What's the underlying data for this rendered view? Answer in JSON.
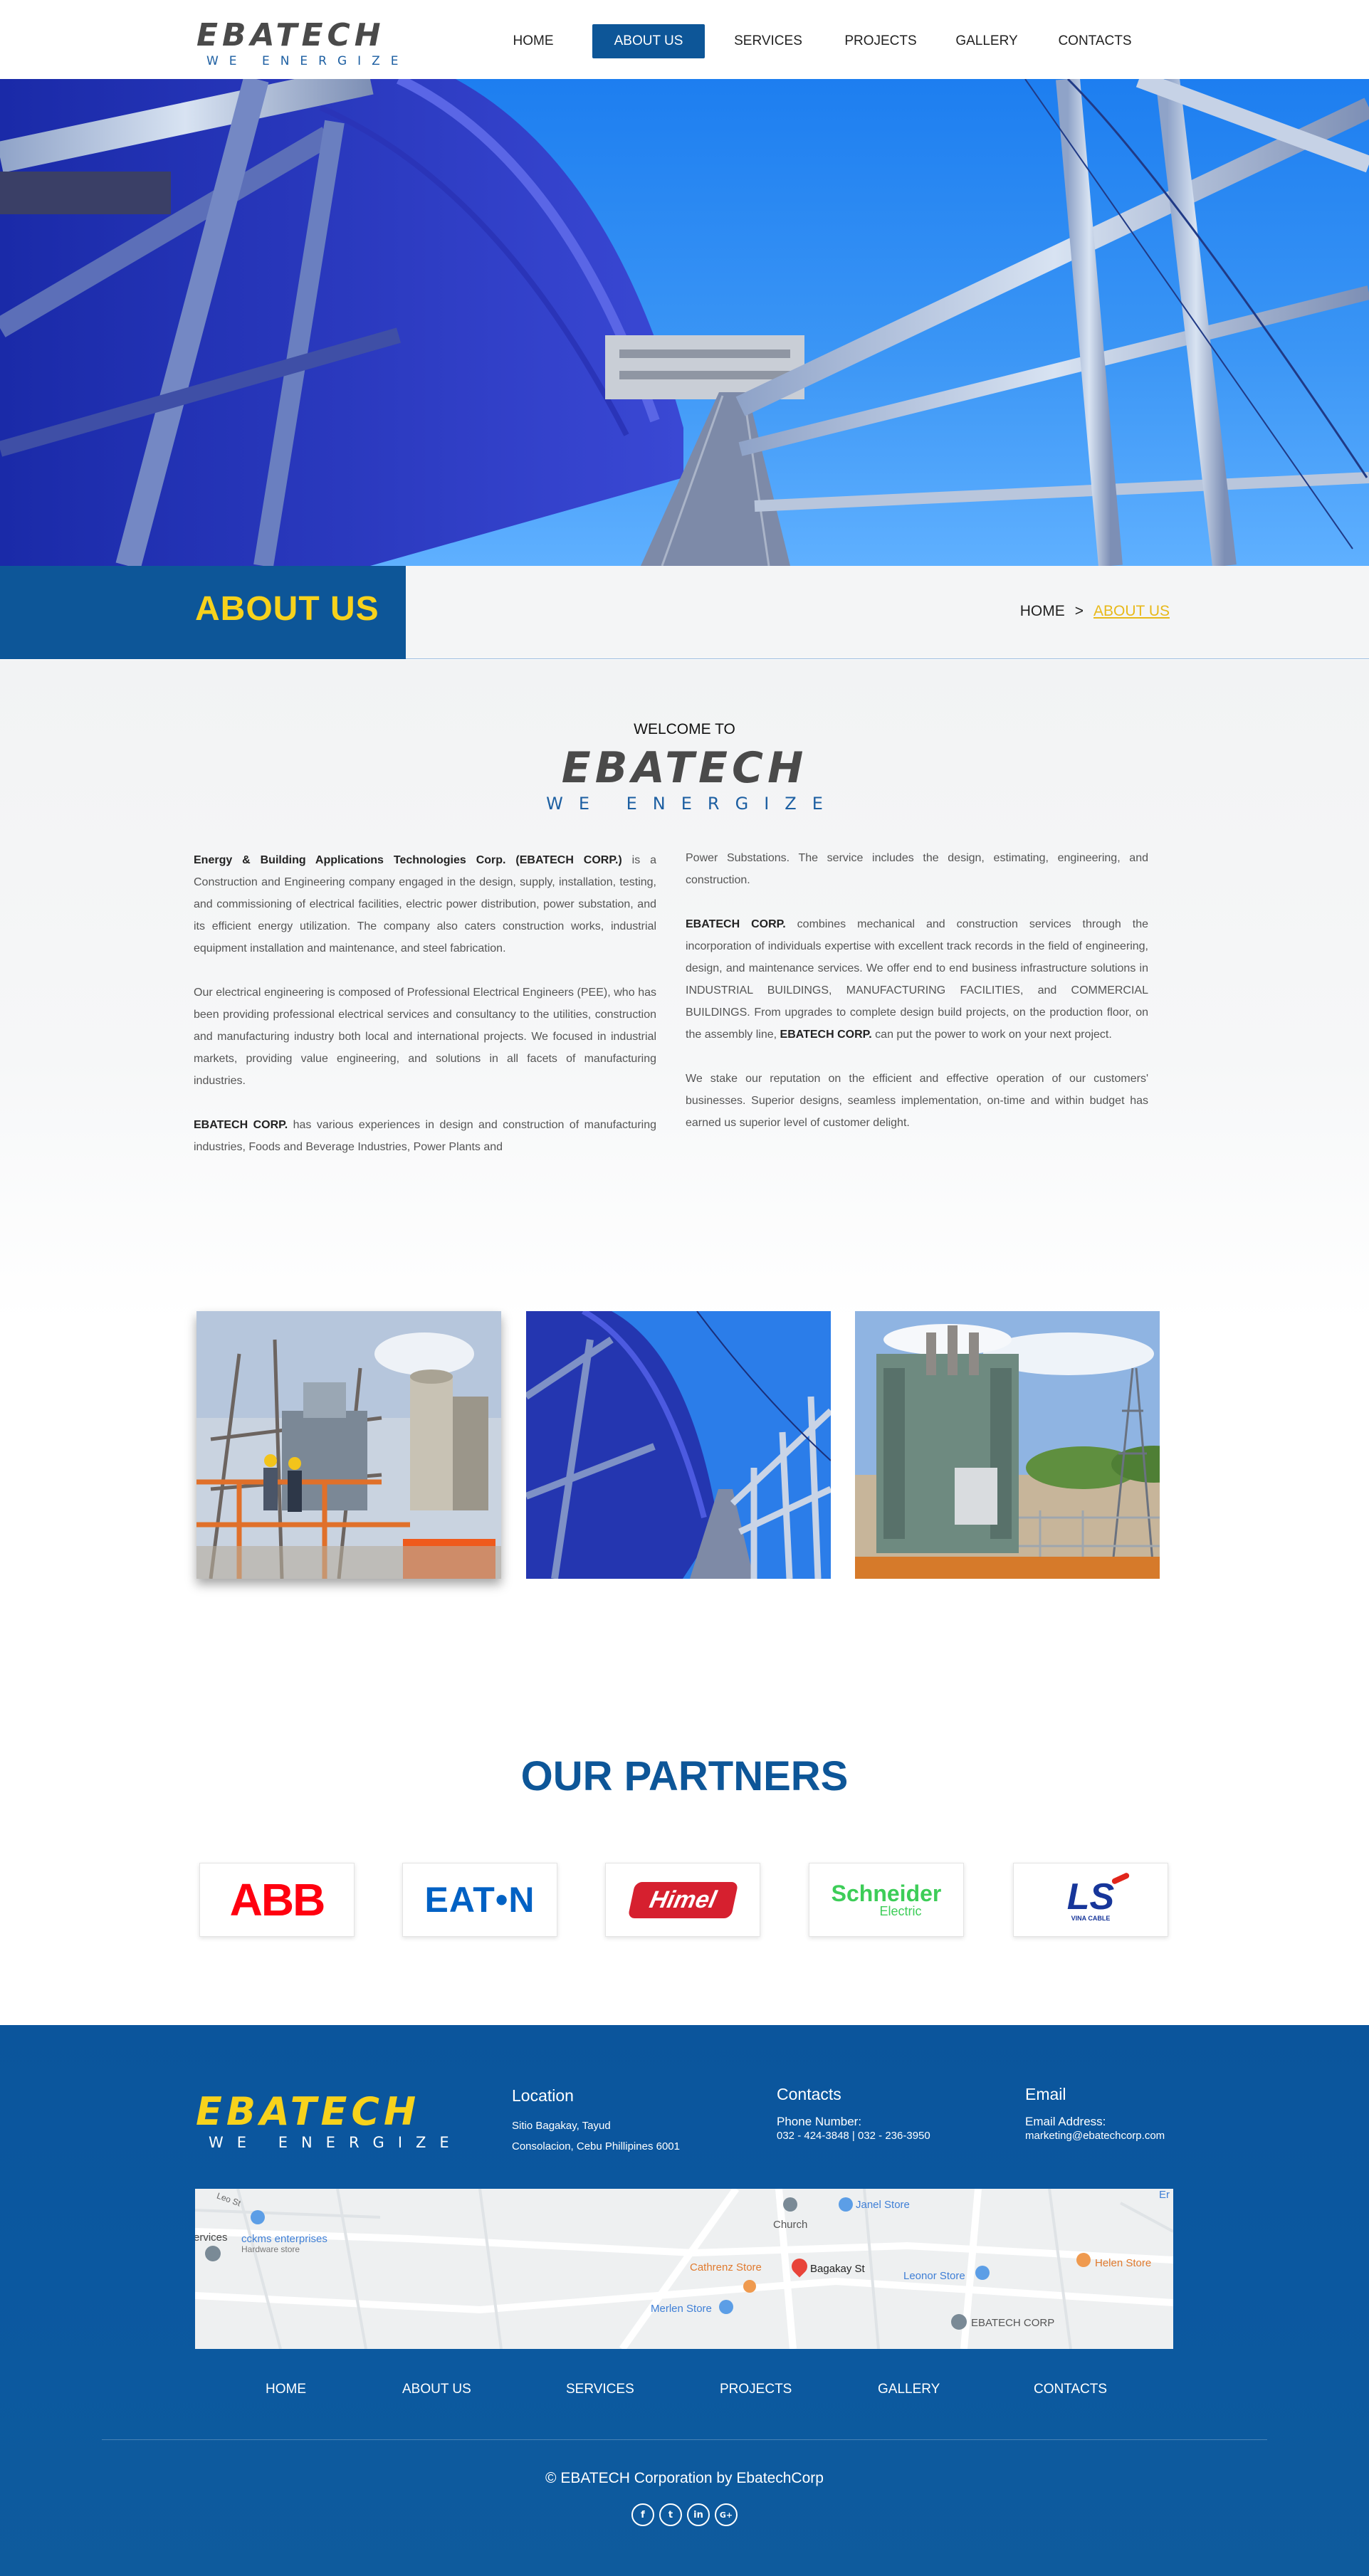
{
  "header": {
    "logo_text": "EBATECH",
    "logo_tagline": "WE ENERGIZE",
    "nav": [
      {
        "label": "HOME"
      },
      {
        "label": "ABOUT US"
      },
      {
        "label": "SERVICES"
      },
      {
        "label": "PROJECTS"
      },
      {
        "label": "GALLERY"
      },
      {
        "label": "CONTACTS"
      }
    ],
    "active_nav": "ABOUT US"
  },
  "banner": {
    "title": "ABOUT US",
    "breadcrumb_home": "HOME",
    "breadcrumb_separator": ">",
    "breadcrumb_current": "ABOUT US"
  },
  "welcome": {
    "heading": "WELCOME TO",
    "logo_text": "EBATECH",
    "logo_tagline": "WE ENERGIZE",
    "p1_bold": "Energy & Building Applications Technologies Corp. (EBATECH CORP.)",
    "p1_rest": " is a Construction and Engineering company engaged in the design, supply, installation, testing, and commissioning of electrical facilities, electric power distribution, power substation, and its efficient energy utilization. The company also caters construction works, industrial equipment installation and maintenance, and steel fabrication.",
    "p2": "Our electrical engineering is composed of Professional Electrical Engineers (PEE), who has been providing professional electrical services and consultancy to the utilities, construction and manufacturing industry both local and international projects. We focused in industrial markets, providing value engineering, and solutions in all facets of manufacturing industries.",
    "p3_bold": "EBATECH CORP.",
    "p3_rest": " has various experiences in design and construction of manufacturing industries, Foods and Beverage Industries, Power Plants and",
    "p4": "Power Substations. The service includes the design, estimating, engineering, and construction.",
    "p5_bold": "EBATECH CORP.",
    "p5_rest": " combines mechanical and construction services through the incorporation of individuals expertise with excellent track records in the field of engineering, design, and maintenance services. We offer end to end business infrastructure solutions in INDUSTRIAL BUILDINGS, MANUFACTURING FACILITIES, and COMMERCIAL BUILDINGS. From upgrades to complete design build projects, on the production floor, on the assembly line, ",
    "p5_bold2": "EBATECH CORP.",
    "p5_rest2": " can put the power to work on your next project.",
    "p6": "We stake our reputation on the efficient and effective operation of our customers' businesses. Superior designs, seamless implementation, on-time and within budget has earned us superior level of customer delight."
  },
  "partners": {
    "title": "OUR PARTNERS",
    "logos": [
      {
        "name": "ABB",
        "color": "#ff000f"
      },
      {
        "name": "EAT•N",
        "color": "#0061c4"
      },
      {
        "name": "Himel",
        "color": "#d6202f"
      },
      {
        "name": "Schneider",
        "sub": "Electric",
        "color": "#3dcd58"
      },
      {
        "name": "LS",
        "sub": "VINA CABLE",
        "color": "#17369a"
      }
    ]
  },
  "footer": {
    "logo_text": "EBATECH",
    "logo_tagline": "WE ENERGIZE",
    "location": {
      "heading": "Location",
      "line1": "Sitio Bagakay, Tayud",
      "line2": "Consolacion, Cebu Phillipines 6001"
    },
    "contacts": {
      "heading": "Contacts",
      "label": "Phone Number:",
      "value": "032 - 424-3848 | 032 - 236-3950"
    },
    "email": {
      "heading": "Email",
      "label": "Email Address:",
      "value": "marketing@ebatechcorp.com"
    },
    "map_labels": {
      "street1": "Leo St",
      "services": "ervices",
      "cckms": "cckms enterprises",
      "hardware": "Hardware store",
      "church": "Church",
      "janel": "Janel Store",
      "cathrenz": "Cathrenz Store",
      "bagakay": "Bagakay St",
      "leonor": "Leonor Store",
      "helen": "Helen Store",
      "merlen": "Merlen Store",
      "ebatech": "EBATECH CORP",
      "edge": "Er"
    },
    "nav": [
      {
        "label": "HOME"
      },
      {
        "label": "ABOUT US"
      },
      {
        "label": "SERVICES"
      },
      {
        "label": "PROJECTS"
      },
      {
        "label": "GALLERY"
      },
      {
        "label": "CONTACTS"
      }
    ],
    "copyright": "© EBATECH Corporation by EbatechCorp",
    "socials": [
      {
        "icon": "facebook-icon",
        "glyph": "f"
      },
      {
        "icon": "twitter-icon",
        "glyph": "t"
      },
      {
        "icon": "linkedin-icon",
        "glyph": "in"
      },
      {
        "icon": "google-plus-icon",
        "glyph": "G+"
      }
    ]
  }
}
